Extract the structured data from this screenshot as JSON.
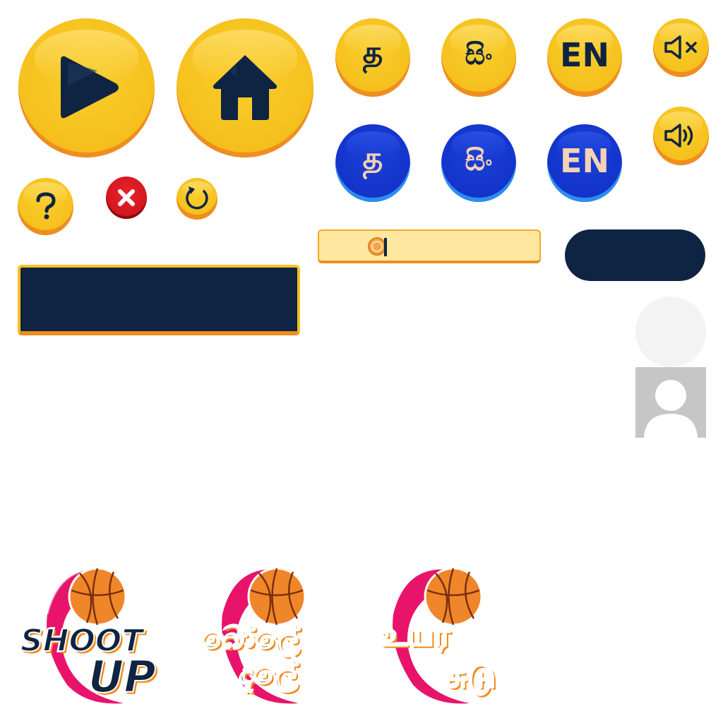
{
  "language_buttons": {
    "tamil": "த",
    "sinhala": "සිං",
    "english": "EN"
  },
  "logos": {
    "english": {
      "line1": "SHOOT",
      "line2": "UP"
    },
    "sinhala": {
      "line1": "බෝලේ",
      "line2": "දැලේ"
    },
    "tamil": {
      "line1": "உயர",
      "line2": "சுடு"
    }
  },
  "colors": {
    "yellow": "#f6c21f",
    "orange_rim": "#f08d1e",
    "blue": "#1435cc",
    "navy": "#0f2442",
    "red": "#d6141e",
    "pink": "#e8146b",
    "ball": "#f0862a"
  },
  "icons": [
    "play-icon",
    "home-icon",
    "help-icon",
    "close-icon",
    "restart-icon",
    "sound-off-icon",
    "sound-on-icon",
    "coin-icon",
    "avatar-icon",
    "basketball-icon"
  ]
}
